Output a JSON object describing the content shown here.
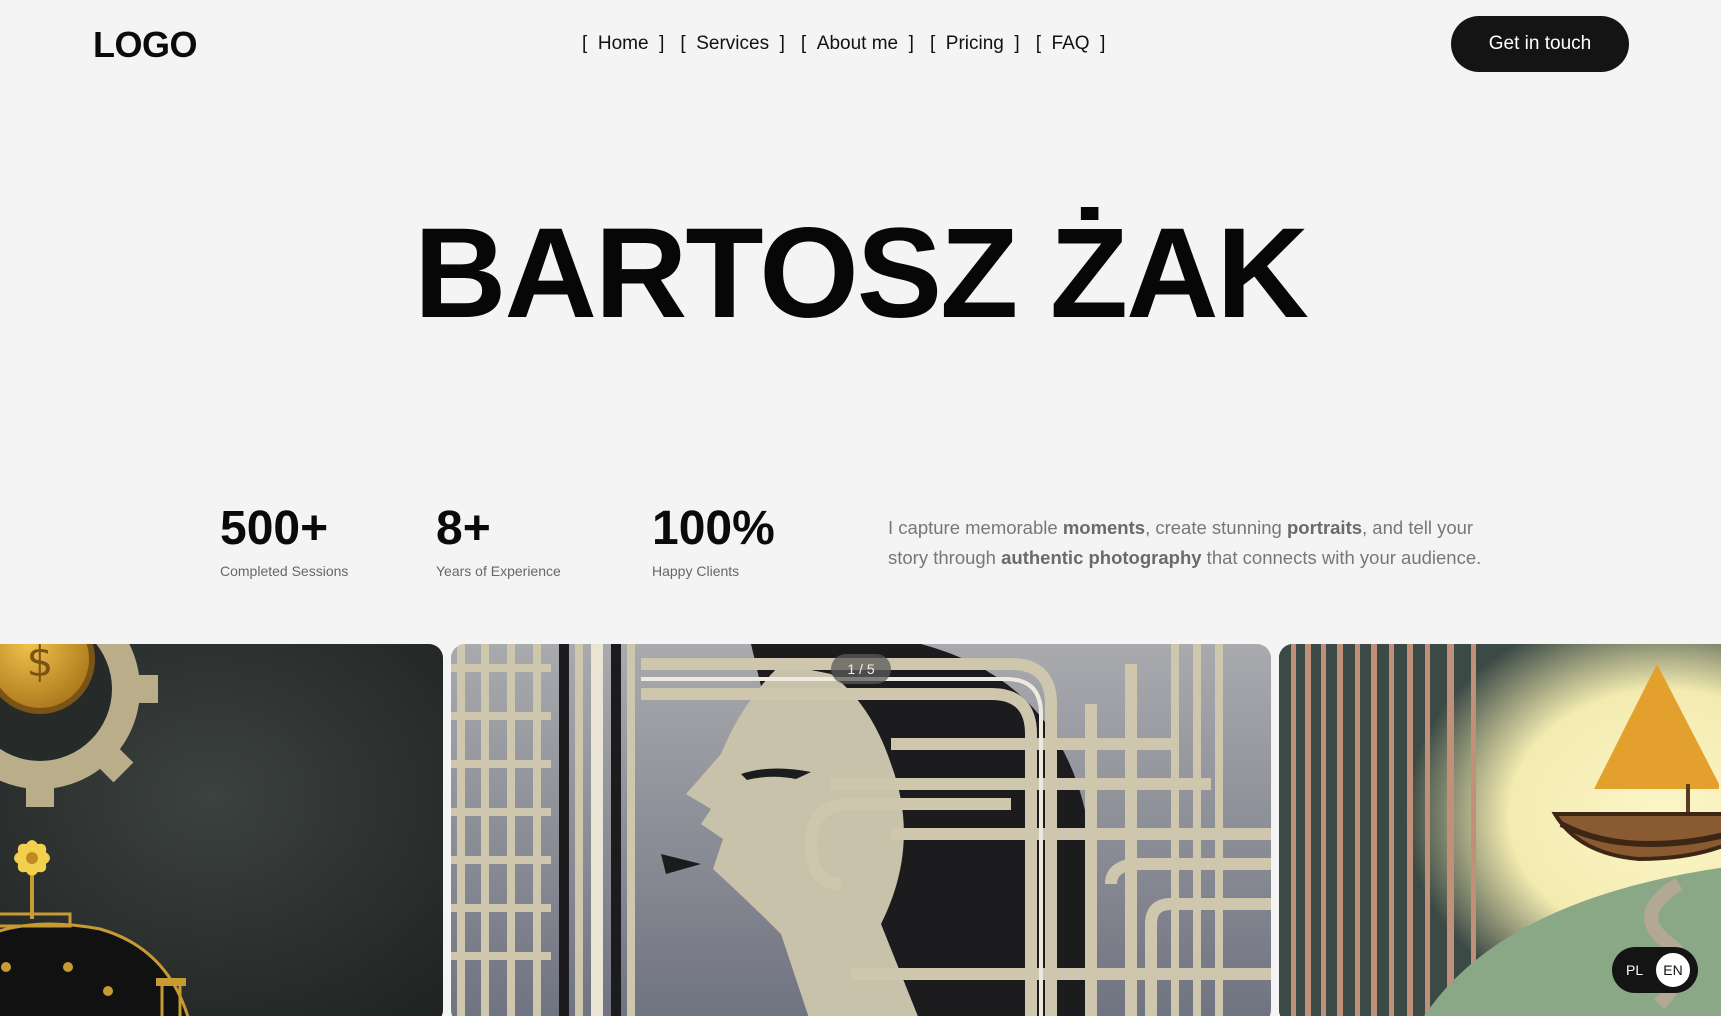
{
  "header": {
    "logo": "LOGO",
    "nav": [
      {
        "label": "Home"
      },
      {
        "label": "Services"
      },
      {
        "label": "About me"
      },
      {
        "label": "Pricing"
      },
      {
        "label": "FAQ"
      }
    ],
    "cta_label": "Get in touch"
  },
  "hero": {
    "title": "BARTOSZ ŻAK"
  },
  "stats": [
    {
      "value": "500+",
      "label": "Completed Sessions"
    },
    {
      "value": "8+",
      "label": "Years of Experience"
    },
    {
      "value": "100%",
      "label": "Happy Clients"
    }
  ],
  "bio": {
    "p1": "I capture memorable ",
    "b1": "moments",
    "p2": ", create stunning ",
    "b2": "portraits",
    "p3": ", and tell your story through ",
    "b3": "authentic photography",
    "p4": " that connects with your audience."
  },
  "gallery": {
    "counter": "1 / 5",
    "images": [
      "steampunk-gear-illustration",
      "art-deco-profile-illustration",
      "sailboat-forest-illustration"
    ]
  },
  "language": {
    "options": [
      "PL",
      "EN"
    ],
    "selected": "EN"
  }
}
